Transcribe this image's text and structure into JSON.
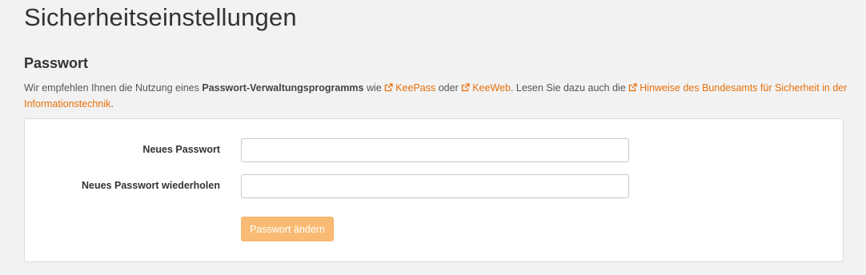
{
  "page_title": "Sicherheitseinstellungen",
  "password_section": {
    "heading": "Passwort",
    "intro": {
      "text_before": "Wir empfehlen Ihnen die Nutzung eines ",
      "bold_text": "Passwort-Verwaltungsprogramms",
      "text_wie": " wie ",
      "link_keepass": "KeePass",
      "text_oder": " oder ",
      "link_keeweb": "KeeWeb",
      "text_middle": ". Lesen Sie dazu auch die ",
      "link_bsi": "Hinweise des Bundesamts für Sicherheit in der Informationstechnik",
      "text_end": "."
    },
    "form": {
      "new_password_label": "Neues Passwort",
      "new_password_value": "",
      "repeat_password_label": "Neues Passwort wiederholen",
      "repeat_password_value": "",
      "submit_label": "Passwort ändern"
    }
  },
  "colors": {
    "link": "#e8700a",
    "button_bg": "#f9bb73",
    "page_bg": "#f2f2f2"
  },
  "icons": {
    "external_link": "external-link-icon"
  }
}
